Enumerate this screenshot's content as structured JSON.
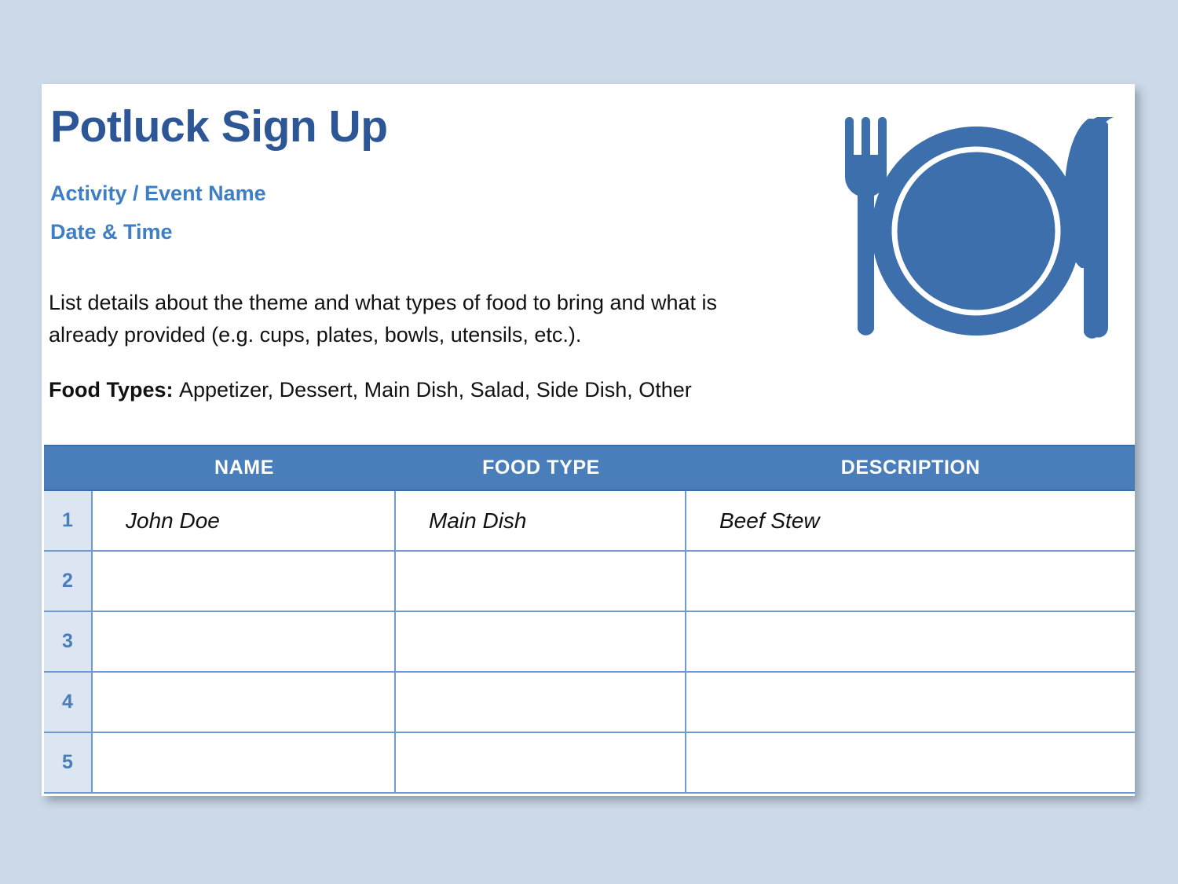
{
  "page": {
    "background_color": "#ccd9e8",
    "card_background": "#ffffff"
  },
  "header": {
    "title": "Potluck Sign Up",
    "subtitle_line1": "Activity / Event Name",
    "subtitle_line2": "Date & Time",
    "title_color": "#2c5696",
    "subtitle_color": "#3d7ec4",
    "description": "List details about the theme and what types of food to bring and what is already provided (e.g. cups, plates, bowls, utensils, etc.).",
    "food_types_label": "Food Types:",
    "food_types_value": "Appetizer, Dessert, Main Dish, Salad, Side Dish, Other",
    "icon": "plate-fork-knife-icon",
    "icon_color": "#3c6fac"
  },
  "table": {
    "header_background": "#4a7ebb",
    "header_text_color": "#ffffff",
    "gridline_color": "#6d9bd1",
    "number_cell_background": "#dce5f2",
    "number_cell_text_color": "#4a7ebb",
    "columns": [
      {
        "key": "num",
        "label": ""
      },
      {
        "key": "name",
        "label": "NAME"
      },
      {
        "key": "food",
        "label": "FOOD TYPE"
      },
      {
        "key": "desc",
        "label": "DESCRIPTION"
      }
    ],
    "rows": [
      {
        "num": "1",
        "name": "John Doe",
        "food": "Main Dish",
        "desc": "Beef Stew"
      },
      {
        "num": "2",
        "name": "",
        "food": "",
        "desc": ""
      },
      {
        "num": "3",
        "name": "",
        "food": "",
        "desc": ""
      },
      {
        "num": "4",
        "name": "",
        "food": "",
        "desc": ""
      },
      {
        "num": "5",
        "name": "",
        "food": "",
        "desc": ""
      }
    ]
  }
}
